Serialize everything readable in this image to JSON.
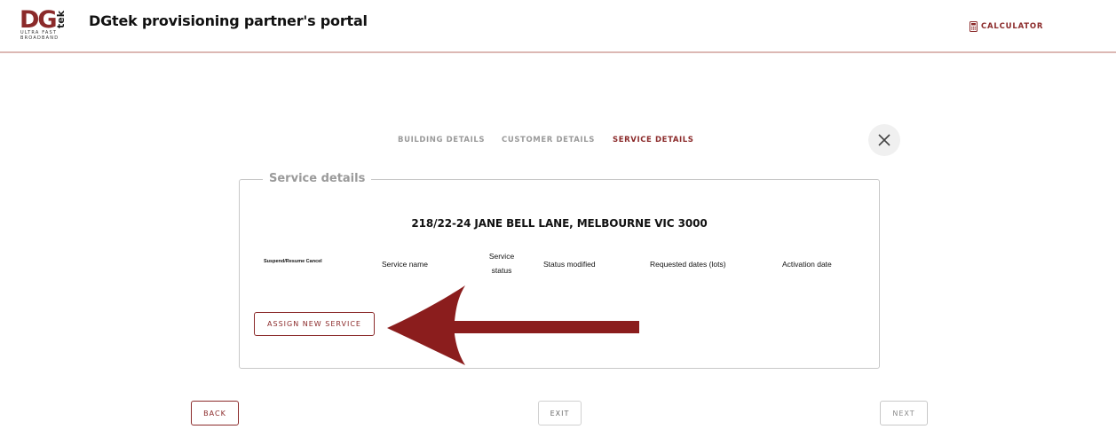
{
  "header": {
    "logo": {
      "main": "DG",
      "side": "tek",
      "tagline_1": "ULTRA FAST",
      "tagline_2": "BROADBAND"
    },
    "title": "DGtek provisioning partner's portal",
    "calculator_label": "CALCULATOR"
  },
  "steps": [
    {
      "label": "BUILDING DETAILS",
      "active": false
    },
    {
      "label": "CUSTOMER DETAILS",
      "active": false
    },
    {
      "label": "SERVICE DETAILS",
      "active": true
    }
  ],
  "panel": {
    "legend": "Service details",
    "address": "218/22-24 JANE BELL LANE, MELBOURNE VIC 3000",
    "columns": {
      "suspend_resume_cancel": "Suspend/Resume Cancel",
      "service_name": "Service name",
      "service_status_1": "Service",
      "service_status_2": "status",
      "status_modified": "Status modified",
      "requested_dates": "Requested dates (lots)",
      "activation_date": "Activation date"
    },
    "assign_button": "ASSIGN NEW SERVICE"
  },
  "footer": {
    "back": "BACK",
    "exit": "EXIT",
    "next": "NEXT"
  },
  "colors": {
    "brand": "#8b2a2a",
    "muted": "#9a9a9a",
    "arrow": "#8b1d1d",
    "header_rule": "#dcb8b4"
  },
  "icons": {
    "calculator": "calculator-icon",
    "close": "close-icon",
    "annotation": "arrow-left-annotation"
  }
}
